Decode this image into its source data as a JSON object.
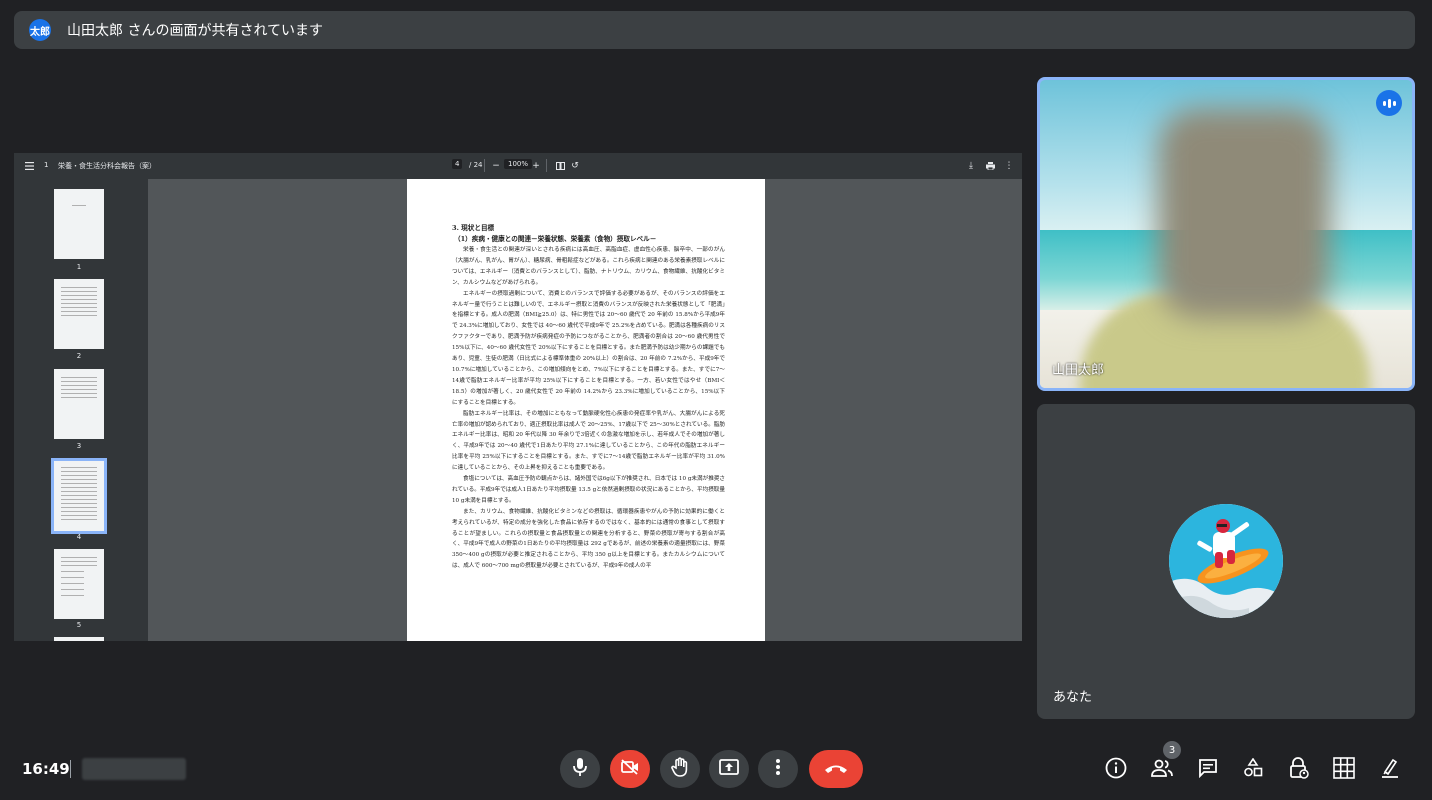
{
  "banner": {
    "avatar_text": "太郎",
    "text": "山田太郎 さんの画面が共有されています"
  },
  "pdf": {
    "doc_number": "1",
    "title": "栄養・食生活分科会報告（案）",
    "page_current": "4",
    "page_total": "/ 24",
    "zoom": "100%",
    "thumbnails": [
      "1",
      "2",
      "3",
      "4",
      "5"
    ],
    "page": {
      "heading": "3. 現状と目標",
      "subheading": "（1）疾病・健康との関連－栄養状態、栄養素（食物）摂取レベル－",
      "paragraphs": [
        "栄養・食生活との関連が深いとされる疾病には高血圧、高脂血症、虚血性心疾患、脳卒中、一部のがん（大腸がん、乳がん、胃がん）、糖尿病、骨粗鬆症などがある。これら疾病と関連のある栄養素摂取レベルについては、エネルギー（消費とのバランスとして）、脂肪、ナトリウム、カリウム、食物繊維、抗酸化ビタミン、カルシウムなどがあげられる。",
        "エネルギーの摂取過剰について、消費とのバランスで評価する必要があるが、そのバランスの評価をエネルギー量で行うことは難しいので、エネルギー摂取と消費のバランスが反映された栄養状態として「肥満」を指標とする。成人の肥満（BMI≧25.0）は、特に男性では 20～60 歳代で 20 年前の 15.8%から平成9年で 24.3%に増加しており、女性では 40～60 歳代で平成9年で 25.2%を占めている。肥満は各種疾病のリスクファクターであり、肥満予防が疾病発症の予防につながることから、肥満者の割合は 20～60 歳代男性で 15%以下に、40～60 歳代女性で 20%以下にすることを目標とする。また肥満予防は幼少期からの課題でもあり、児童、生徒の肥満（日比式による標準体重の 20%以上）の割合は、20 年前の 7.2%から、平成9年で 10.7%に増加していることから、この増加傾向をとめ、7%以下にすることを目標とする。また、すでに7～14歳で脂肪エネルギー比率が平均 25%以下にすることを目標とする。一方、若い女性ではやせ（BMI＜18.5）の増加が著しく、20 歳代女性で 20 年前の 14.2%から 23.3%に増加していることから、15%以下にすることを目標とする。",
        "脂肪エネルギー比率は、その増加にともなって動脈硬化性心疾患の発症率や乳がん、大腸がんによる死亡率の増加が認められており、適正摂取比率は成人で 20～25%、17歳以下で 25～30%とされている。脂肪エネルギー比率は、昭和 20 年代以降 30 年余りで3倍近くの急激な増加を示し、若年成人でその増加が著しく、平成9年では 20～40 歳代で1日あたり平均 27.1%に達していることから、この年代の脂肪エネルギー比率を平均 25%以下にすることを目標とする。また、すでに7～14歳で脂肪エネルギー比率が平均 31.0%に達していることから、その上昇を抑えることも重要である。",
        "食塩については、高血圧予防の観点からは、諸外国では6g以下が推奨され、日本では 10 g未満が推奨されている。平成9年では成人1日あたり平均摂取量 13.5 gと依然過剰摂取の状況にあることから、平均摂取量 10 g未満を目標とする。",
        "また、カリウム、食物繊維、抗酸化ビタミンなどの摂取は、循環器疾患やがんの予防に効果的に働くと考えられているが、特定の成分を強化した食品に依存するのではなく、基本的には通常の食事として摂取することが望ましい。これらの摂取量と食品摂取量との関連を分析すると、野菜の摂取が寄与する割合が高く、平成9年で成人の野菜の1日あたりの平均摂取量は 292 gであるが、前述の栄養素の適量摂取には、野菜 350～400 gの摂取が必要と推定されることから、平均 350 g以上を目標とする。またカルシウムについては、成人で 600～700 mgの摂取量が必要とされているが、平成9年の成人の平"
      ]
    }
  },
  "tiles": {
    "remote": {
      "name": "山田太郎"
    },
    "self": {
      "name": "あなた"
    }
  },
  "bottom": {
    "time": "16:49",
    "people_count": "3"
  },
  "colors": {
    "background": "#202124",
    "tile": "#3c4043",
    "accent": "#8ab4f8",
    "danger": "#ea4335",
    "brand_blue": "#1a73e8"
  },
  "icons": {
    "mic": "mic-icon",
    "camera_off": "camera-off-icon",
    "raise_hand": "raise-hand-icon",
    "present": "present-screen-icon",
    "more": "more-vert-icon",
    "end_call": "end-call-icon",
    "info": "info-icon",
    "people": "people-icon",
    "chat": "chat-icon",
    "activities": "activities-icon",
    "host_controls": "lock-person-icon",
    "layout": "grid-icon",
    "companion": "companion-icon"
  }
}
